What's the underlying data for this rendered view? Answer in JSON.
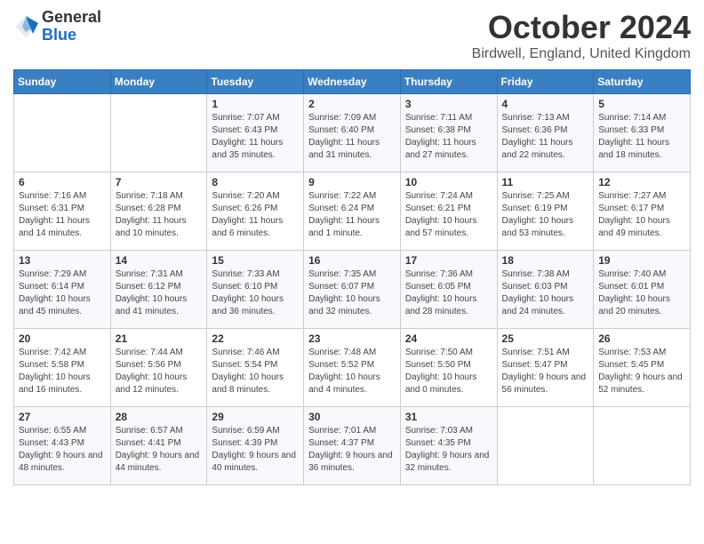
{
  "header": {
    "logo_general": "General",
    "logo_blue": "Blue",
    "title": "October 2024",
    "location": "Birdwell, England, United Kingdom"
  },
  "days_of_week": [
    "Sunday",
    "Monday",
    "Tuesday",
    "Wednesday",
    "Thursday",
    "Friday",
    "Saturday"
  ],
  "weeks": [
    [
      {
        "day": "",
        "info": ""
      },
      {
        "day": "",
        "info": ""
      },
      {
        "day": "1",
        "info": "Sunrise: 7:07 AM\nSunset: 6:43 PM\nDaylight: 11 hours and 35 minutes."
      },
      {
        "day": "2",
        "info": "Sunrise: 7:09 AM\nSunset: 6:40 PM\nDaylight: 11 hours and 31 minutes."
      },
      {
        "day": "3",
        "info": "Sunrise: 7:11 AM\nSunset: 6:38 PM\nDaylight: 11 hours and 27 minutes."
      },
      {
        "day": "4",
        "info": "Sunrise: 7:13 AM\nSunset: 6:36 PM\nDaylight: 11 hours and 22 minutes."
      },
      {
        "day": "5",
        "info": "Sunrise: 7:14 AM\nSunset: 6:33 PM\nDaylight: 11 hours and 18 minutes."
      }
    ],
    [
      {
        "day": "6",
        "info": "Sunrise: 7:16 AM\nSunset: 6:31 PM\nDaylight: 11 hours and 14 minutes."
      },
      {
        "day": "7",
        "info": "Sunrise: 7:18 AM\nSunset: 6:28 PM\nDaylight: 11 hours and 10 minutes."
      },
      {
        "day": "8",
        "info": "Sunrise: 7:20 AM\nSunset: 6:26 PM\nDaylight: 11 hours and 6 minutes."
      },
      {
        "day": "9",
        "info": "Sunrise: 7:22 AM\nSunset: 6:24 PM\nDaylight: 11 hours and 1 minute."
      },
      {
        "day": "10",
        "info": "Sunrise: 7:24 AM\nSunset: 6:21 PM\nDaylight: 10 hours and 57 minutes."
      },
      {
        "day": "11",
        "info": "Sunrise: 7:25 AM\nSunset: 6:19 PM\nDaylight: 10 hours and 53 minutes."
      },
      {
        "day": "12",
        "info": "Sunrise: 7:27 AM\nSunset: 6:17 PM\nDaylight: 10 hours and 49 minutes."
      }
    ],
    [
      {
        "day": "13",
        "info": "Sunrise: 7:29 AM\nSunset: 6:14 PM\nDaylight: 10 hours and 45 minutes."
      },
      {
        "day": "14",
        "info": "Sunrise: 7:31 AM\nSunset: 6:12 PM\nDaylight: 10 hours and 41 minutes."
      },
      {
        "day": "15",
        "info": "Sunrise: 7:33 AM\nSunset: 6:10 PM\nDaylight: 10 hours and 36 minutes."
      },
      {
        "day": "16",
        "info": "Sunrise: 7:35 AM\nSunset: 6:07 PM\nDaylight: 10 hours and 32 minutes."
      },
      {
        "day": "17",
        "info": "Sunrise: 7:36 AM\nSunset: 6:05 PM\nDaylight: 10 hours and 28 minutes."
      },
      {
        "day": "18",
        "info": "Sunrise: 7:38 AM\nSunset: 6:03 PM\nDaylight: 10 hours and 24 minutes."
      },
      {
        "day": "19",
        "info": "Sunrise: 7:40 AM\nSunset: 6:01 PM\nDaylight: 10 hours and 20 minutes."
      }
    ],
    [
      {
        "day": "20",
        "info": "Sunrise: 7:42 AM\nSunset: 5:58 PM\nDaylight: 10 hours and 16 minutes."
      },
      {
        "day": "21",
        "info": "Sunrise: 7:44 AM\nSunset: 5:56 PM\nDaylight: 10 hours and 12 minutes."
      },
      {
        "day": "22",
        "info": "Sunrise: 7:46 AM\nSunset: 5:54 PM\nDaylight: 10 hours and 8 minutes."
      },
      {
        "day": "23",
        "info": "Sunrise: 7:48 AM\nSunset: 5:52 PM\nDaylight: 10 hours and 4 minutes."
      },
      {
        "day": "24",
        "info": "Sunrise: 7:50 AM\nSunset: 5:50 PM\nDaylight: 10 hours and 0 minutes."
      },
      {
        "day": "25",
        "info": "Sunrise: 7:51 AM\nSunset: 5:47 PM\nDaylight: 9 hours and 56 minutes."
      },
      {
        "day": "26",
        "info": "Sunrise: 7:53 AM\nSunset: 5:45 PM\nDaylight: 9 hours and 52 minutes."
      }
    ],
    [
      {
        "day": "27",
        "info": "Sunrise: 6:55 AM\nSunset: 4:43 PM\nDaylight: 9 hours and 48 minutes."
      },
      {
        "day": "28",
        "info": "Sunrise: 6:57 AM\nSunset: 4:41 PM\nDaylight: 9 hours and 44 minutes."
      },
      {
        "day": "29",
        "info": "Sunrise: 6:59 AM\nSunset: 4:39 PM\nDaylight: 9 hours and 40 minutes."
      },
      {
        "day": "30",
        "info": "Sunrise: 7:01 AM\nSunset: 4:37 PM\nDaylight: 9 hours and 36 minutes."
      },
      {
        "day": "31",
        "info": "Sunrise: 7:03 AM\nSunset: 4:35 PM\nDaylight: 9 hours and 32 minutes."
      },
      {
        "day": "",
        "info": ""
      },
      {
        "day": "",
        "info": ""
      }
    ]
  ]
}
